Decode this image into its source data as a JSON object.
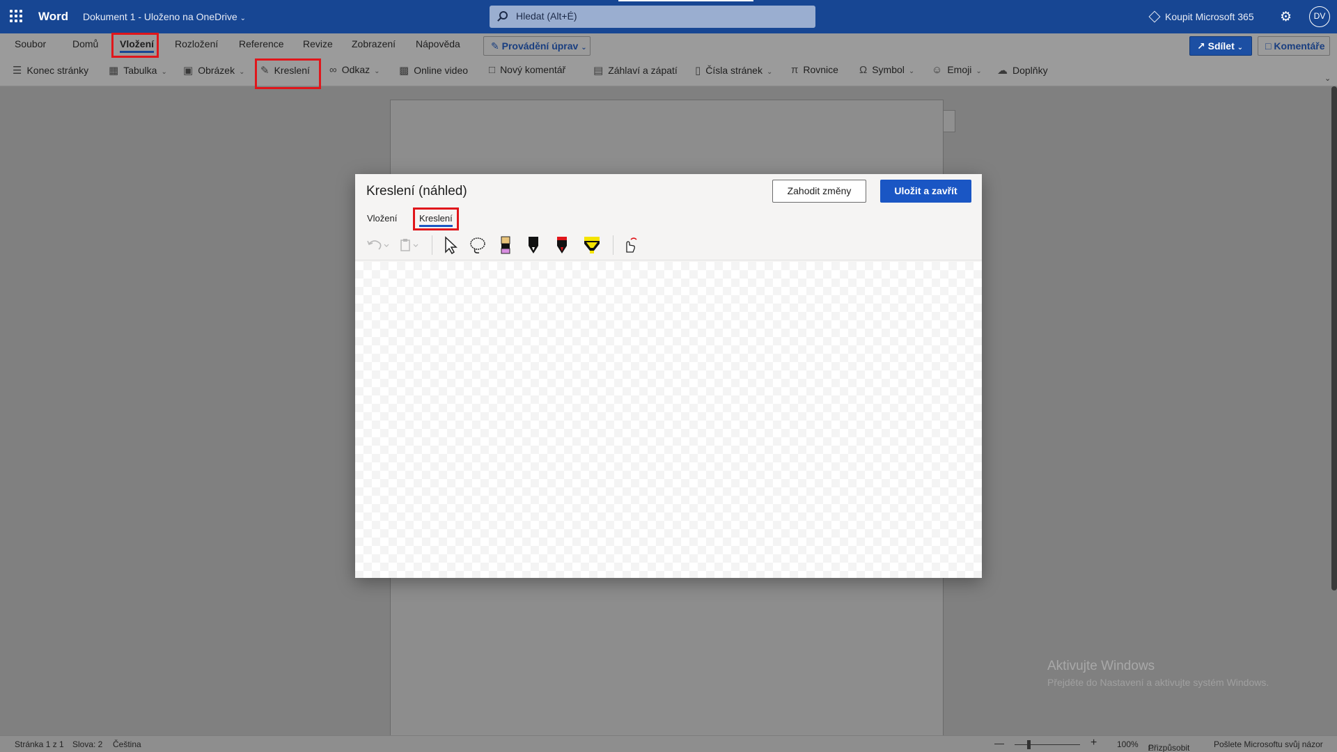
{
  "titlebar": {
    "app_name": "Word",
    "doc_title": "Dokument 1 - Uloženo na OneDrive",
    "search_placeholder": "Hledat (Alt+É)",
    "buy_label": "Koupit Microsoft 365",
    "avatar_initials": "DV"
  },
  "ribbon": {
    "tabs": [
      "Soubor",
      "Domů",
      "Vložení",
      "Rozložení",
      "Reference",
      "Revize",
      "Zobrazení",
      "Nápověda"
    ],
    "active_tab": "Vložení",
    "editing_mode": "Provádění úprav",
    "share_label": "Sdílet",
    "comments_label": "Komentáře",
    "commands": [
      {
        "label": "Konec stránky",
        "icon": "page-break-icon"
      },
      {
        "label": "Tabulka",
        "icon": "table-icon"
      },
      {
        "label": "Obrázek",
        "icon": "picture-icon"
      },
      {
        "label": "Kreslení",
        "icon": "draw-icon"
      },
      {
        "label": "Odkaz",
        "icon": "link-icon"
      },
      {
        "label": "Online video",
        "icon": "video-icon"
      },
      {
        "label": "Nový komentář",
        "icon": "comment-icon"
      },
      {
        "label": "Záhlaví a zápatí",
        "icon": "header-footer-icon"
      },
      {
        "label": "Čísla stránek",
        "icon": "page-numbers-icon"
      },
      {
        "label": "Rovnice",
        "icon": "equation-icon"
      },
      {
        "label": "Symbol",
        "icon": "symbol-icon"
      },
      {
        "label": "Emoji",
        "icon": "emoji-icon"
      },
      {
        "label": "Doplňky",
        "icon": "addins-icon"
      }
    ]
  },
  "dialog": {
    "title": "Kreslení (náhled)",
    "discard_label": "Zahodit změny",
    "save_label": "Uložit a zavřít",
    "tabs": [
      "Vložení",
      "Kreslení"
    ],
    "active_tab": "Kreslení",
    "tools": [
      "undo-icon",
      "paste-icon",
      "select-arrow-icon",
      "lasso-icon",
      "eraser-icon",
      "black-pen-icon",
      "red-pen-icon",
      "yellow-highlighter-icon",
      "ink-to-shape-icon"
    ]
  },
  "watermark": {
    "title": "Aktivujte Windows",
    "subtitle": "Přejděte do Nastavení a aktivujte systém Windows."
  },
  "status": {
    "page": "Stránka 1 z 1",
    "words": "Slova: 2",
    "language": "Čeština",
    "zoom": "100%",
    "fit": "Přizpůsobit",
    "feedback": "Pošlete Microsoftu svůj názor"
  },
  "colors": {
    "accent": "#174693",
    "save_button": "#1a56c4",
    "highlight_box": "#e0161b"
  }
}
